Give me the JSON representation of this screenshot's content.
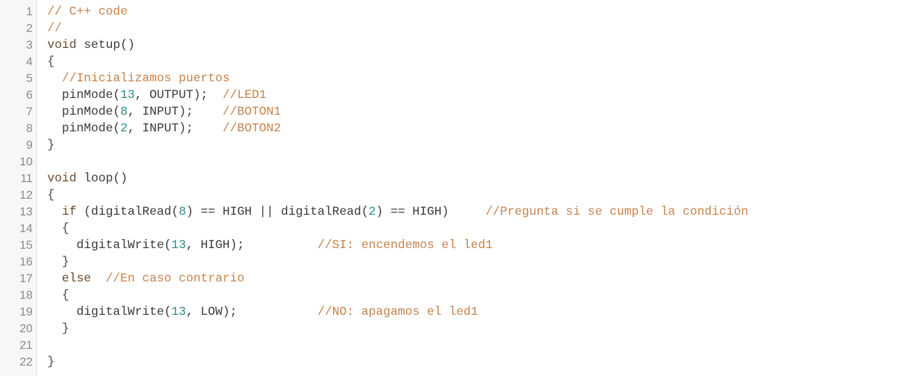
{
  "lines": [
    {
      "n": "1",
      "tokens": [
        {
          "t": "// C++ code",
          "c": "cm"
        }
      ]
    },
    {
      "n": "2",
      "tokens": [
        {
          "t": "//",
          "c": "cm"
        }
      ]
    },
    {
      "n": "3",
      "tokens": [
        {
          "t": "void",
          "c": "kw"
        },
        {
          "t": " setup()",
          "c": "fn"
        }
      ]
    },
    {
      "n": "4",
      "tokens": [
        {
          "t": "{",
          "c": "pn"
        }
      ]
    },
    {
      "n": "5",
      "tokens": [
        {
          "t": "  "
        },
        {
          "t": "//Inicializamos puertos",
          "c": "cm"
        }
      ]
    },
    {
      "n": "6",
      "tokens": [
        {
          "t": "  pinMode(",
          "c": "fn"
        },
        {
          "t": "13",
          "c": "num"
        },
        {
          "t": ", OUTPUT);  ",
          "c": "fn"
        },
        {
          "t": "//LED1",
          "c": "cm"
        }
      ]
    },
    {
      "n": "7",
      "tokens": [
        {
          "t": "  pinMode(",
          "c": "fn"
        },
        {
          "t": "8",
          "c": "num"
        },
        {
          "t": ", INPUT);    ",
          "c": "fn"
        },
        {
          "t": "//BOTON1",
          "c": "cm"
        }
      ]
    },
    {
      "n": "8",
      "tokens": [
        {
          "t": "  pinMode(",
          "c": "fn"
        },
        {
          "t": "2",
          "c": "num"
        },
        {
          "t": ", INPUT);    ",
          "c": "fn"
        },
        {
          "t": "//BOTON2",
          "c": "cm"
        }
      ]
    },
    {
      "n": "9",
      "tokens": [
        {
          "t": "}",
          "c": "pn"
        }
      ]
    },
    {
      "n": "10",
      "tokens": []
    },
    {
      "n": "11",
      "tokens": [
        {
          "t": "void",
          "c": "kw"
        },
        {
          "t": " loop()",
          "c": "fn"
        }
      ]
    },
    {
      "n": "12",
      "tokens": [
        {
          "t": "{",
          "c": "pn"
        }
      ]
    },
    {
      "n": "13",
      "tokens": [
        {
          "t": "  "
        },
        {
          "t": "if",
          "c": "kw"
        },
        {
          "t": " (digitalRead(",
          "c": "fn"
        },
        {
          "t": "8",
          "c": "num"
        },
        {
          "t": ") == HIGH || digitalRead(",
          "c": "fn"
        },
        {
          "t": "2",
          "c": "num"
        },
        {
          "t": ") == HIGH)     ",
          "c": "fn"
        },
        {
          "t": "//Pregunta si se cumple la condición",
          "c": "cm"
        }
      ]
    },
    {
      "n": "14",
      "tokens": [
        {
          "t": "  {",
          "c": "pn"
        }
      ]
    },
    {
      "n": "15",
      "tokens": [
        {
          "t": "    digitalWrite(",
          "c": "fn"
        },
        {
          "t": "13",
          "c": "num"
        },
        {
          "t": ", HIGH);          ",
          "c": "fn"
        },
        {
          "t": "//SI: encendemos el led1",
          "c": "cm"
        }
      ]
    },
    {
      "n": "16",
      "tokens": [
        {
          "t": "  }",
          "c": "pn"
        }
      ]
    },
    {
      "n": "17",
      "tokens": [
        {
          "t": "  "
        },
        {
          "t": "else",
          "c": "kw"
        },
        {
          "t": "  "
        },
        {
          "t": "//En caso contrario",
          "c": "cm"
        }
      ]
    },
    {
      "n": "18",
      "tokens": [
        {
          "t": "  {",
          "c": "pn"
        }
      ]
    },
    {
      "n": "19",
      "tokens": [
        {
          "t": "    digitalWrite(",
          "c": "fn"
        },
        {
          "t": "13",
          "c": "num"
        },
        {
          "t": ", LOW);           ",
          "c": "fn"
        },
        {
          "t": "//NO: apagamos el led1",
          "c": "cm"
        }
      ]
    },
    {
      "n": "20",
      "tokens": [
        {
          "t": "  }",
          "c": "pn"
        }
      ]
    },
    {
      "n": "21",
      "tokens": []
    },
    {
      "n": "22",
      "tokens": [
        {
          "t": "}",
          "c": "pn"
        }
      ]
    }
  ]
}
